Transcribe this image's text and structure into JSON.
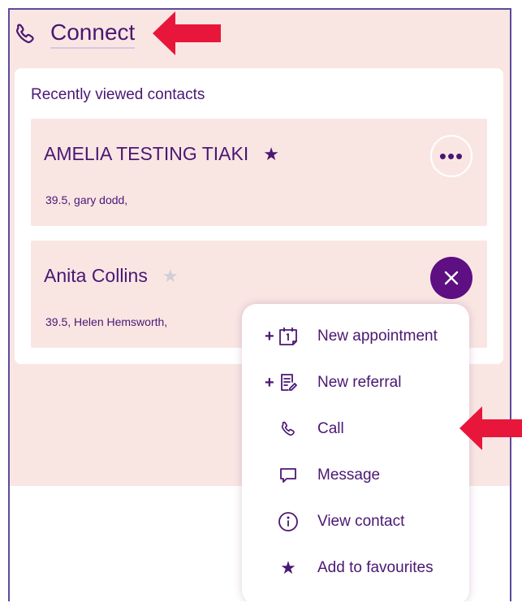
{
  "header": {
    "title": "Connect",
    "icon": "phone-icon"
  },
  "panel": {
    "subtitle": "Recently viewed contacts",
    "contacts": [
      {
        "name": "AMELIA TESTING TIAKI",
        "detail": "39.5, gary dodd,",
        "favourite": true,
        "more_label": "•••"
      },
      {
        "name": "Anita Collins",
        "detail": "39.5, Helen Hemsworth,",
        "favourite": false
      }
    ]
  },
  "menu": {
    "items": [
      {
        "label": "New appointment",
        "plus": "+",
        "icon": "calendar-icon"
      },
      {
        "label": "New referral",
        "plus": "+",
        "icon": "referral-icon"
      },
      {
        "label": "Call",
        "icon": "phone-icon"
      },
      {
        "label": "Message",
        "icon": "message-icon"
      },
      {
        "label": "View contact",
        "icon": "info-icon"
      },
      {
        "label": "Add to favourites",
        "icon": "star-icon"
      }
    ]
  },
  "colors": {
    "brand": "#4a1773",
    "accent": "#5e0f82",
    "background": "#f9e6e3",
    "arrow": "#e8163a",
    "star_inactive": "#cfcfd6"
  }
}
